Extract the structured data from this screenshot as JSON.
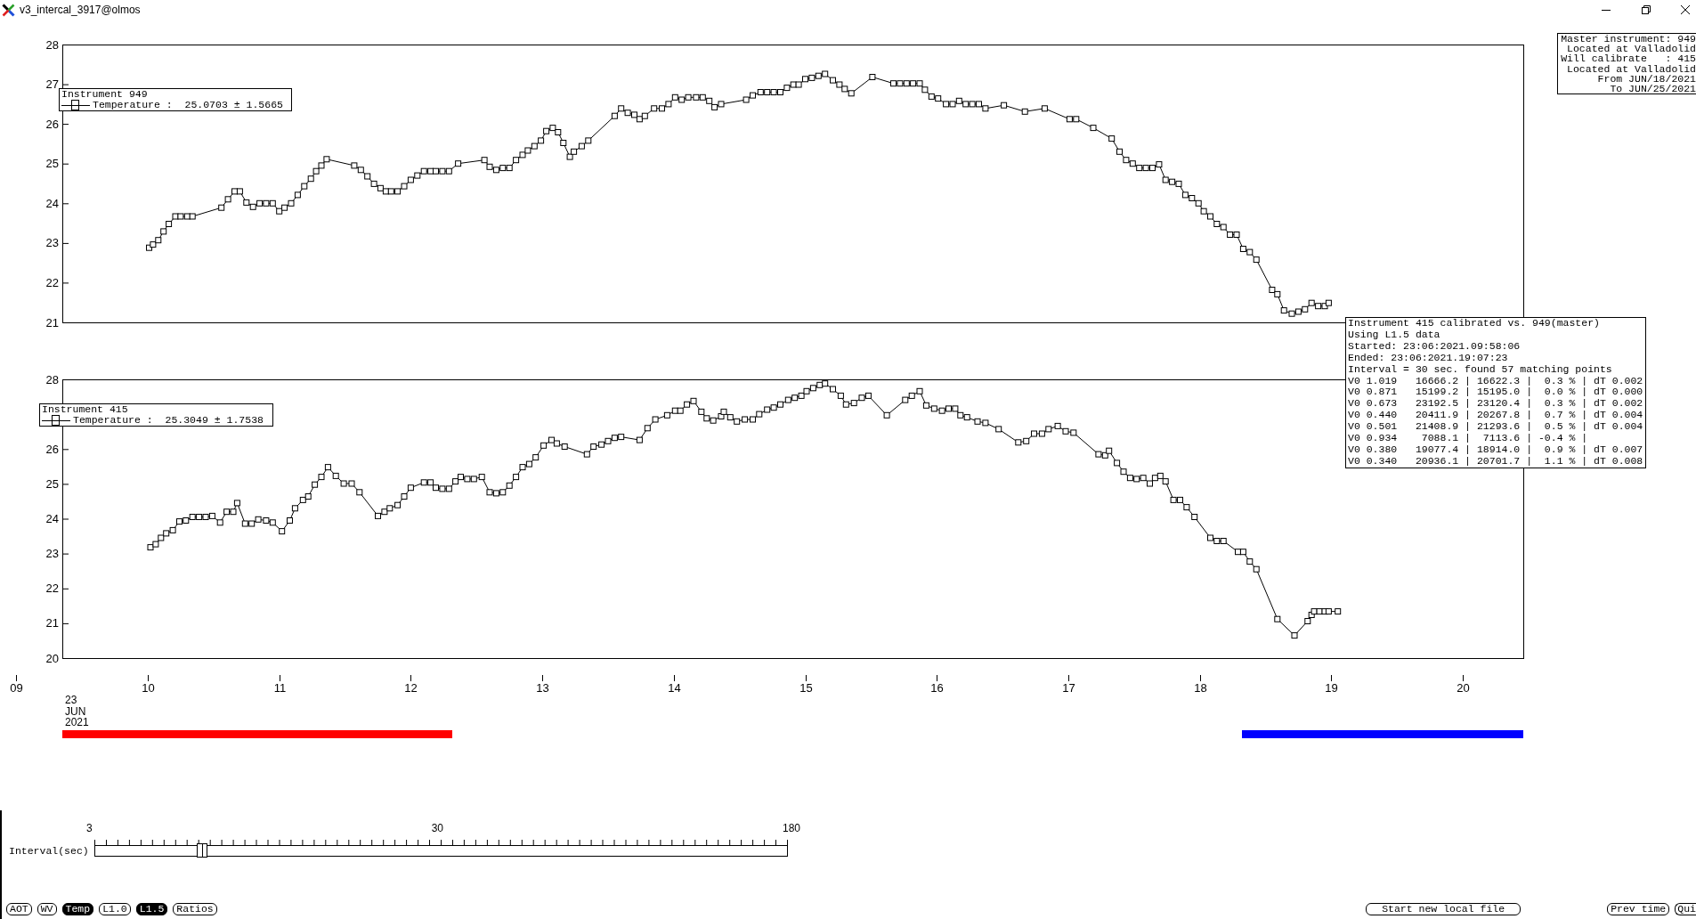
{
  "window": {
    "title": "v3_intercal_3917@olmos"
  },
  "master_info": {
    "lines": [
      "Master instrument: 949",
      "Located at Valladolid",
      "Will calibrate   : 415",
      "Located at Valladolid",
      "From JUN/18/2021",
      "To JUN/25/2021"
    ]
  },
  "plots": [
    {
      "legend": {
        "title": "Instrument 949",
        "value": ":  25.0703 ± 1.5665"
      },
      "chart_data": {
        "type": "line",
        "x": [
          10.01,
          10.04,
          10.08,
          10.12,
          10.16,
          10.21,
          10.25,
          10.3,
          10.34,
          10.56,
          10.61,
          10.66,
          10.7,
          10.75,
          10.8,
          10.85,
          10.9,
          10.95,
          11.0,
          11.04,
          11.09,
          11.14,
          11.19,
          11.24,
          11.28,
          11.32,
          11.36,
          11.57,
          11.62,
          11.67,
          11.72,
          11.77,
          11.81,
          11.85,
          11.9,
          11.95,
          12.0,
          12.05,
          12.1,
          12.15,
          12.19,
          12.24,
          12.29,
          12.36,
          12.56,
          12.6,
          12.65,
          12.7,
          12.75,
          12.8,
          12.85,
          12.89,
          12.94,
          12.99,
          13.03,
          13.08,
          13.12,
          13.16,
          13.21,
          13.24,
          13.3,
          13.35,
          13.55,
          13.6,
          13.65,
          13.7,
          13.74,
          13.78,
          13.85,
          13.91,
          13.96,
          14.01,
          14.06,
          14.11,
          14.17,
          14.22,
          14.27,
          14.31,
          14.36,
          14.55,
          14.6,
          14.66,
          14.71,
          14.76,
          14.81,
          14.86,
          14.91,
          14.95,
          15.0,
          15.05,
          15.1,
          15.15,
          15.21,
          15.26,
          15.3,
          15.35,
          15.51,
          15.67,
          15.72,
          15.77,
          15.82,
          15.87,
          15.91,
          15.96,
          16.01,
          16.07,
          16.12,
          16.17,
          16.22,
          16.27,
          16.32,
          16.37,
          16.51,
          16.67,
          16.82,
          17.01,
          17.06,
          17.19,
          17.33,
          17.39,
          17.44,
          17.49,
          17.54,
          17.59,
          17.64,
          17.69,
          17.74,
          17.79,
          17.84,
          17.89,
          17.94,
          17.99,
          18.03,
          18.08,
          18.13,
          18.18,
          18.23,
          18.28,
          18.33,
          18.38,
          18.43,
          18.55,
          18.59,
          18.64,
          18.7,
          18.75,
          18.8,
          18.85,
          18.9,
          18.95,
          18.98
        ],
        "series": [
          {
            "name": "Temperature",
            "color": "#000000",
            "marker": "square",
            "values": [
              22.88,
              22.96,
              23.07,
              23.29,
              23.48,
              23.67,
              23.67,
              23.67,
              23.67,
              23.89,
              24.1,
              24.3,
              24.3,
              24.02,
              23.91,
              24.0,
              24.0,
              24.0,
              23.8,
              23.89,
              24.0,
              24.21,
              24.43,
              24.62,
              24.81,
              24.95,
              25.11,
              24.95,
              24.84,
              24.68,
              24.49,
              24.38,
              24.3,
              24.3,
              24.3,
              24.43,
              24.59,
              24.7,
              24.81,
              24.81,
              24.81,
              24.81,
              24.81,
              25.0,
              25.09,
              24.92,
              24.84,
              24.89,
              24.89,
              25.09,
              25.22,
              25.33,
              25.44,
              25.58,
              25.82,
              25.9,
              25.79,
              25.52,
              25.17,
              25.3,
              25.44,
              25.58,
              26.2,
              26.39,
              26.28,
              26.23,
              26.12,
              26.2,
              26.39,
              26.39,
              26.5,
              26.67,
              26.61,
              26.67,
              26.67,
              26.67,
              26.58,
              26.42,
              26.5,
              26.61,
              26.72,
              26.8,
              26.8,
              26.8,
              26.8,
              26.91,
              26.99,
              26.99,
              27.13,
              27.16,
              27.21,
              27.26,
              27.1,
              26.99,
              26.88,
              26.77,
              27.18,
              27.02,
              27.02,
              27.02,
              27.02,
              27.02,
              26.86,
              26.69,
              26.64,
              26.5,
              26.5,
              26.58,
              26.5,
              26.5,
              26.5,
              26.39,
              26.47,
              26.31,
              26.39,
              26.12,
              26.12,
              25.9,
              25.63,
              25.3,
              25.09,
              25.0,
              24.89,
              24.89,
              24.89,
              24.98,
              24.59,
              24.54,
              24.49,
              24.21,
              24.13,
              24.0,
              23.8,
              23.67,
              23.48,
              23.4,
              23.21,
              23.21,
              22.85,
              22.77,
              22.58,
              21.82,
              21.71,
              21.3,
              21.22,
              21.27,
              21.33,
              21.49,
              21.41,
              21.41,
              21.49
            ]
          }
        ],
        "xlim": [
          9.35,
          20.46
        ],
        "ylim": [
          21,
          28
        ],
        "yticks": [
          21,
          22,
          23,
          24,
          25,
          26,
          27,
          28
        ]
      }
    },
    {
      "legend": {
        "title": "Instrument 415",
        "value": ":  25.3049 ± 1.7538"
      },
      "axis_start_label": "09",
      "date_label": [
        "23",
        "JUN",
        "2021"
      ],
      "range_bars": [
        {
          "color": "#ff0000"
        },
        {
          "color": "#0000ff"
        }
      ],
      "chart_data": {
        "type": "line",
        "x": [
          10.02,
          10.06,
          10.1,
          10.14,
          10.19,
          10.24,
          10.29,
          10.34,
          10.39,
          10.44,
          10.49,
          10.55,
          10.6,
          10.65,
          10.68,
          10.74,
          10.79,
          10.84,
          10.9,
          10.95,
          11.02,
          11.08,
          11.12,
          11.18,
          11.22,
          11.27,
          11.32,
          11.37,
          11.43,
          11.49,
          11.55,
          11.61,
          11.75,
          11.8,
          11.84,
          11.9,
          11.95,
          12.0,
          12.1,
          12.15,
          12.19,
          12.24,
          12.29,
          12.34,
          12.38,
          12.43,
          12.48,
          12.54,
          12.6,
          12.65,
          12.7,
          12.75,
          12.8,
          12.85,
          12.9,
          12.95,
          13.01,
          13.07,
          13.11,
          13.17,
          13.34,
          13.39,
          13.45,
          13.5,
          13.55,
          13.6,
          13.74,
          13.8,
          13.86,
          13.95,
          14.01,
          14.05,
          14.1,
          14.15,
          14.21,
          14.25,
          14.3,
          14.36,
          14.38,
          14.43,
          14.48,
          14.54,
          14.6,
          14.65,
          14.71,
          14.76,
          14.81,
          14.87,
          14.92,
          14.97,
          15.01,
          15.06,
          15.11,
          15.15,
          15.21,
          15.27,
          15.31,
          15.37,
          15.43,
          15.48,
          15.62,
          15.76,
          15.81,
          15.87,
          15.92,
          15.98,
          16.04,
          16.09,
          16.14,
          16.18,
          16.23,
          16.31,
          16.37,
          16.47,
          16.62,
          16.68,
          16.74,
          16.8,
          16.85,
          16.92,
          16.98,
          17.04,
          17.23,
          17.28,
          17.31,
          17.37,
          17.42,
          17.47,
          17.52,
          17.57,
          17.62,
          17.66,
          17.7,
          17.74,
          17.8,
          17.85,
          17.9,
          17.96,
          18.08,
          18.13,
          18.18,
          18.29,
          18.33,
          18.38,
          18.43,
          18.59,
          18.72,
          18.82,
          18.85,
          18.87,
          18.91,
          18.95,
          18.98,
          19.05
        ],
        "series": [
          {
            "name": "Temperature",
            "color": "#000000",
            "marker": "square",
            "values": [
              23.18,
              23.27,
              23.45,
              23.58,
              23.67,
              23.92,
              23.95,
              24.05,
              24.05,
              24.05,
              24.08,
              23.89,
              24.2,
              24.2,
              24.45,
              23.86,
              23.86,
              23.98,
              23.95,
              23.89,
              23.64,
              23.95,
              24.3,
              24.54,
              24.64,
              24.98,
              25.2,
              25.48,
              25.23,
              25.01,
              25.01,
              24.76,
              24.08,
              24.2,
              24.3,
              24.39,
              24.64,
              24.89,
              25.04,
              25.04,
              24.89,
              24.86,
              24.86,
              25.07,
              25.2,
              25.14,
              25.14,
              25.2,
              24.76,
              24.73,
              24.76,
              24.95,
              25.2,
              25.48,
              25.57,
              25.76,
              26.1,
              26.26,
              26.16,
              26.07,
              25.85,
              26.07,
              26.13,
              26.23,
              26.32,
              26.35,
              26.26,
              26.6,
              26.85,
              26.97,
              27.1,
              27.1,
              27.28,
              27.38,
              27.07,
              26.88,
              26.82,
              26.94,
              27.07,
              26.91,
              26.79,
              26.85,
              26.85,
              27.0,
              27.13,
              27.19,
              27.28,
              27.41,
              27.47,
              27.53,
              27.66,
              27.75,
              27.84,
              27.88,
              27.72,
              27.53,
              27.28,
              27.32,
              27.47,
              27.53,
              26.97,
              27.41,
              27.53,
              27.66,
              27.25,
              27.16,
              27.1,
              27.16,
              27.16,
              26.97,
              26.91,
              26.79,
              26.75,
              26.57,
              26.19,
              26.23,
              26.44,
              26.44,
              26.57,
              26.66,
              26.51,
              26.47,
              25.85,
              25.82,
              25.95,
              25.6,
              25.35,
              25.17,
              25.14,
              25.17,
              25.01,
              25.17,
              25.23,
              25.07,
              24.54,
              24.54,
              24.33,
              24.05,
              23.45,
              23.36,
              23.36,
              23.05,
              23.05,
              22.77,
              22.55,
              21.12,
              20.65,
              21.06,
              21.24,
              21.34,
              21.34,
              21.34,
              21.34,
              21.34
            ]
          }
        ],
        "xlim": [
          9.35,
          20.46
        ],
        "ylim": [
          20,
          28
        ],
        "yticks": [
          20,
          21,
          22,
          23,
          24,
          25,
          26,
          28
        ],
        "xticks": [
          {
            "value": 10,
            "label": "10"
          },
          {
            "value": 11,
            "label": "11"
          },
          {
            "value": 12,
            "label": "12"
          },
          {
            "value": 13,
            "label": "13"
          },
          {
            "value": 14,
            "label": "14"
          },
          {
            "value": 15,
            "label": "15"
          },
          {
            "value": 16,
            "label": "16"
          },
          {
            "value": 17,
            "label": "17"
          },
          {
            "value": 18,
            "label": "18"
          },
          {
            "value": 19,
            "label": "19"
          },
          {
            "value": 20,
            "label": "20"
          }
        ]
      }
    }
  ],
  "calibration_report": {
    "lines": [
      "Instrument 415 calibrated vs. 949(master)",
      "Using L1.5 data",
      "Started: 23:06:2021.09:58:06",
      "Ended: 23:06:2021.19:07:23",
      "Interval = 30 sec. found 57 matching points",
      "V0 1.019   16666.2 | 16622.3 |  0.3 % | dT 0.002",
      "V0 0.871   15199.2 | 15195.0 |  0.0 % | dT 0.000",
      "V0 0.673   23192.5 | 23120.4 |  0.3 % | dT 0.002",
      "V0 0.440   20411.9 | 20267.8 |  0.7 % | dT 0.004",
      "V0 0.501   21408.9 | 21293.6 |  0.5 % | dT 0.004",
      "V0 0.934    7088.1 |  7113.6 | -0.4 % |",
      "V0 0.380   19077.4 | 18914.0 |  0.9 % | dT 0.007",
      "V0 0.340   20936.1 | 20701.7 |  1.1 % | dT 0.008"
    ]
  },
  "interval_slider": {
    "label": "Interval(sec)",
    "min_label": "3",
    "value_label": "30",
    "max_label": "180",
    "level": 0.155
  },
  "mode_buttons": [
    {
      "label": "AOT",
      "selected": false
    },
    {
      "label": "WV",
      "selected": false
    },
    {
      "label": "Temp",
      "selected": true
    },
    {
      "label": "L1.0",
      "selected": false
    },
    {
      "label": "L1.5",
      "selected": true
    },
    {
      "label": "Ratios",
      "selected": false
    }
  ],
  "action_buttons": [
    {
      "label": "Start new local file"
    },
    {
      "label": "Prev time"
    },
    {
      "label": "Qui"
    }
  ]
}
